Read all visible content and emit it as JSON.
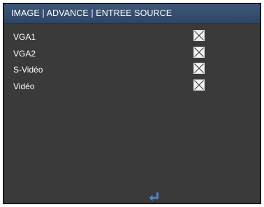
{
  "title": "IMAGE | ADVANCE | ENTREE SOURCE",
  "sources": [
    {
      "label": "VGA1",
      "checked": true
    },
    {
      "label": "VGA2",
      "checked": true
    },
    {
      "label": "S-Vidéo",
      "checked": true
    },
    {
      "label": "Vidéo",
      "checked": true
    }
  ],
  "footer": {
    "enter_icon": "enter-return-icon"
  },
  "colors": {
    "background": "#3a3a3a",
    "title_bar": "#3e5778",
    "text": "#ffffff",
    "checkbox_fill": "#f2f2f2",
    "check_mark": "#333333",
    "enter_icon": "#4f82d0"
  }
}
